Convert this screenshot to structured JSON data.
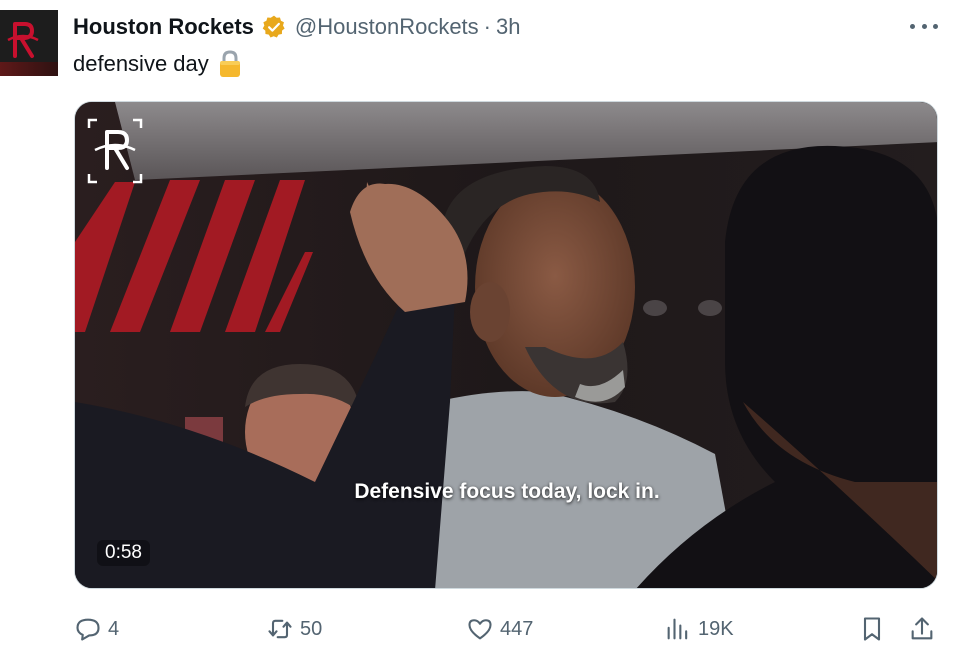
{
  "tweet": {
    "author_name": "Houston Rockets",
    "handle": "@HoustonRockets",
    "separator": "·",
    "time": "3h",
    "text": "defensive day",
    "text_emoji_icon": "lock-icon"
  },
  "media": {
    "caption": "Defensive focus today, lock in.",
    "duration": "0:58",
    "brand_icon": "rockets-logo-icon"
  },
  "actions": {
    "replies": "4",
    "reposts": "50",
    "likes": "447",
    "views": "19K"
  },
  "colors": {
    "text": "#0f1419",
    "muted": "#536471",
    "verified_gold": "#e8a81c",
    "rockets_red": "#ce1141"
  }
}
